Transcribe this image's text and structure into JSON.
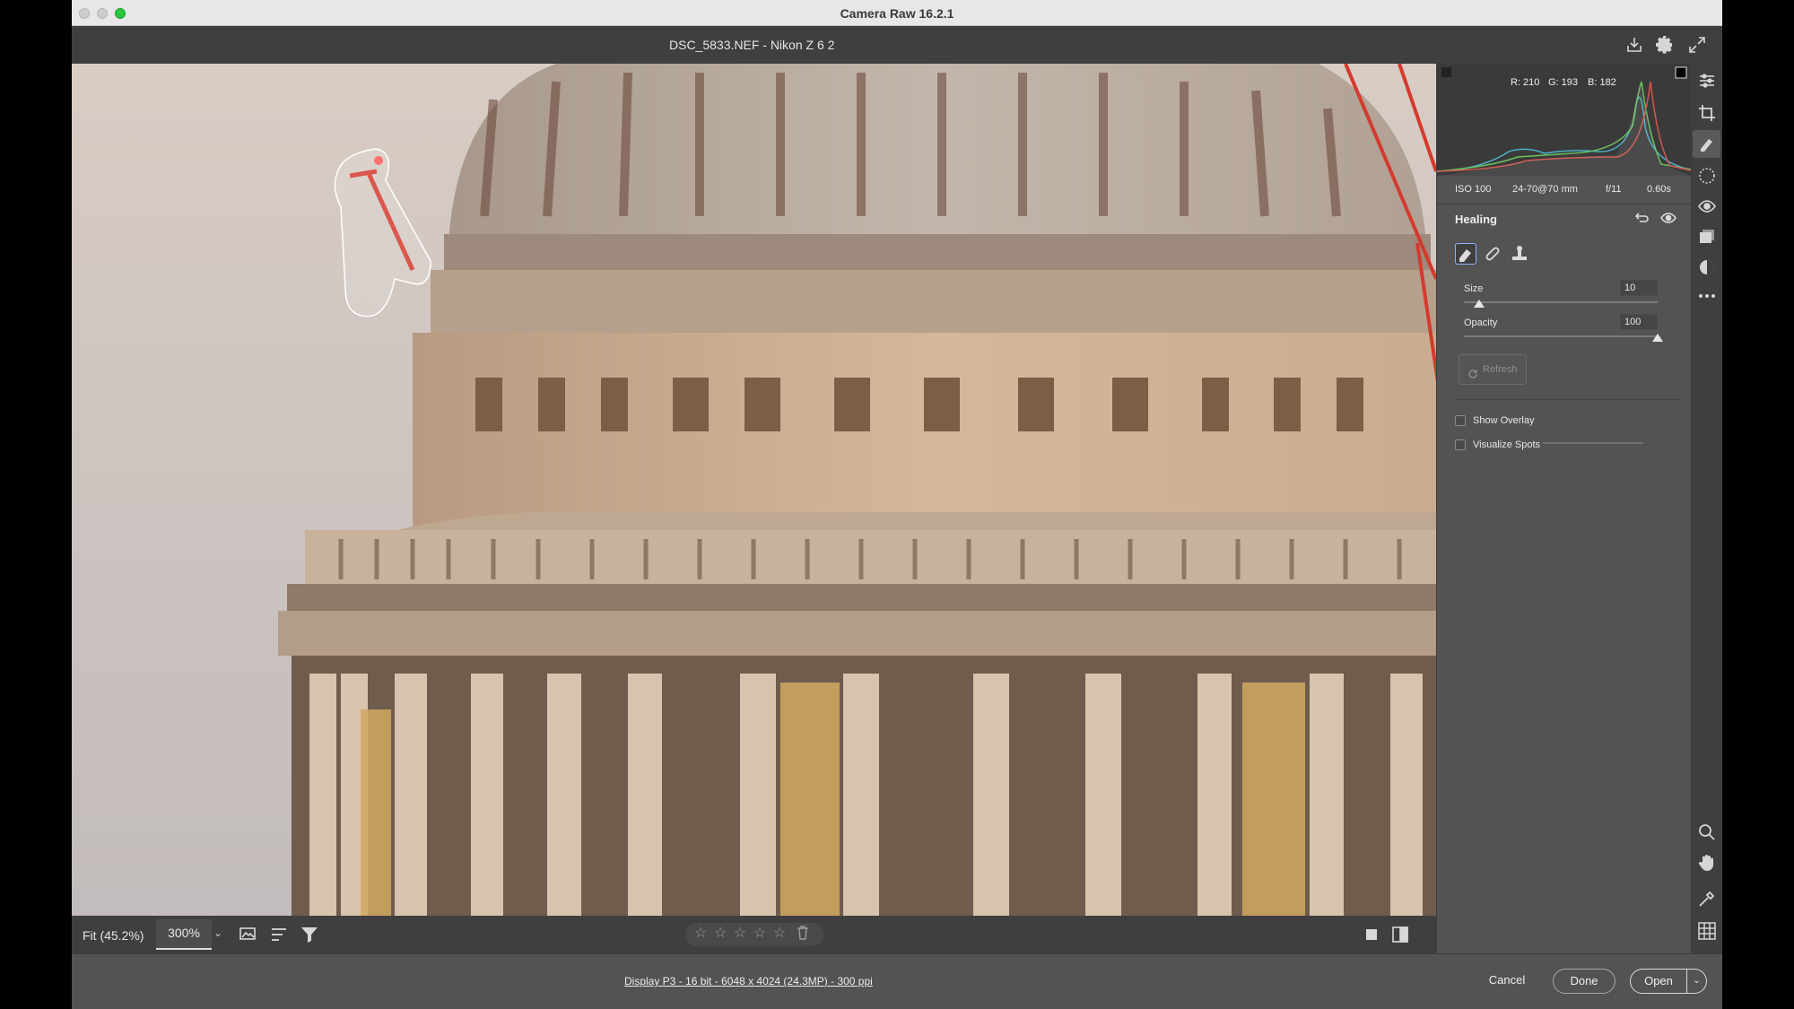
{
  "window": {
    "app_title": "Camera Raw 16.2.1",
    "file_title": "DSC_5833.NEF  -  Nikon Z 6 2"
  },
  "header_icons": [
    "save-icon",
    "settings-icon",
    "fullscreen-icon"
  ],
  "histogram": {
    "r_label": "R: 210",
    "g_label": "G: 193",
    "b_label": "B: 182"
  },
  "exif": {
    "iso": "ISO 100",
    "lens": "24-70@70 mm",
    "aperture": "f/11",
    "shutter": "0.60s"
  },
  "healing": {
    "title": "Healing",
    "tools": [
      "content-aware-remove-icon",
      "heal-icon",
      "clone-icon"
    ],
    "size_label": "Size",
    "size_value": "10",
    "size_level": 0.08,
    "opacity_label": "Opacity",
    "opacity_value": "100",
    "opacity_level": 1.0,
    "refresh_label": "Refresh",
    "show_overlay_label": "Show Overlay",
    "visualize_spots_label": "Visualize Spots"
  },
  "bottom_bar": {
    "fit_label": "Fit (45.2%)",
    "zoom_value": "300%",
    "icons": [
      "sample-overlay-icon",
      "sort-icon",
      "filter-icon",
      "single-view-icon",
      "before-after-icon"
    ],
    "rating_stars": 0
  },
  "footer": {
    "workflow_link": "Display P3 - 16 bit - 6048 x 4024 (24.3MP) - 300 ppi",
    "cancel_label": "Cancel",
    "done_label": "Done",
    "open_label": "Open"
  },
  "tool_strip": [
    "edit-icon",
    "crop-icon",
    "healing-icon",
    "masking-icon",
    "red-eye-icon",
    "snapshots-icon",
    "presets-icon",
    "more-icon",
    "zoom-icon",
    "hand-icon",
    "color-sampler-icon",
    "grid-icon"
  ],
  "colors": {
    "accent": "#8ab4f8",
    "crane": "#d43a2e",
    "panel_bg": "#535353",
    "bar_bg": "#3f3f3f"
  }
}
